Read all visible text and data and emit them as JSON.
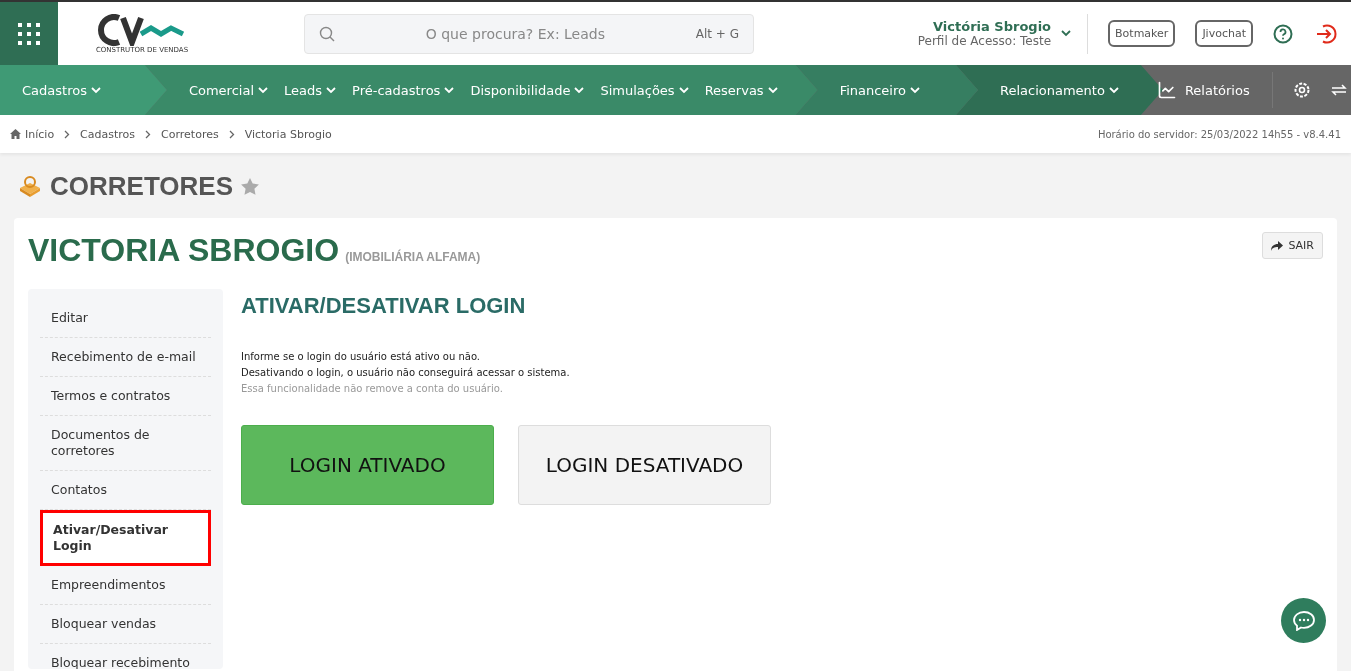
{
  "header": {
    "logo_tagline": "CONSTRUTOR DE VENDAS",
    "search": {
      "placeholder": "O que procura? Ex: Leads",
      "shortcut": "Alt + G"
    },
    "user": {
      "name": "Victória Sbrogio",
      "profile": "Perfil de Acesso: Teste"
    },
    "buttons": [
      "Botmaker",
      "Jivochat"
    ]
  },
  "nav": {
    "groups": [
      {
        "color": "#3f9a75",
        "items": [
          "Cadastros"
        ]
      },
      {
        "color": "#3a8a68",
        "items": [
          "Comercial",
          "Leads",
          "Pré-cadastros",
          "Disponibilidade",
          "Simulações",
          "Reservas"
        ]
      },
      {
        "color": "#367e61",
        "items": [
          "Financeiro"
        ]
      },
      {
        "color": "#2f6e54",
        "items": [
          "Relacionamento"
        ]
      }
    ],
    "reports": "Relatórios"
  },
  "breadcrumb": [
    "Início",
    "Cadastros",
    "Corretores",
    "Victoria Sbrogio"
  ],
  "server_time": "Horário do servidor: 25/03/2022 14h55 - v8.4.41",
  "page_title": "CORRETORES",
  "record": {
    "name": "VICTORIA SBROGIO",
    "company": "(IMOBILIÁRIA ALFAMA)",
    "exit_button": "SAIR"
  },
  "sidebar": {
    "items": [
      {
        "label": "Editar",
        "selected": false
      },
      {
        "label": "Recebimento de e-mail",
        "selected": false
      },
      {
        "label": "Termos e contratos",
        "selected": false
      },
      {
        "label": "Documentos de corretores",
        "selected": false
      },
      {
        "label": "Contatos",
        "selected": false
      },
      {
        "label": "Ativar/Desativar Login",
        "selected": true
      },
      {
        "label": "Empreendimentos",
        "selected": false
      },
      {
        "label": "Bloquear vendas",
        "selected": false
      },
      {
        "label": "Bloquear recebimento",
        "selected": false
      }
    ]
  },
  "section": {
    "title": "ATIVAR/DESATIVAR LOGIN",
    "lines": [
      "Informe se o login do usuário está ativo ou não.",
      "Desativando o login, o usuário não conseguirá acessar o sistema."
    ],
    "note": "Essa funcionalidade não remove a conta do usuário.",
    "login_buttons": [
      {
        "label": "LOGIN ATIVADO",
        "selected": true
      },
      {
        "label": "LOGIN DESATIVADO",
        "selected": false
      }
    ]
  }
}
